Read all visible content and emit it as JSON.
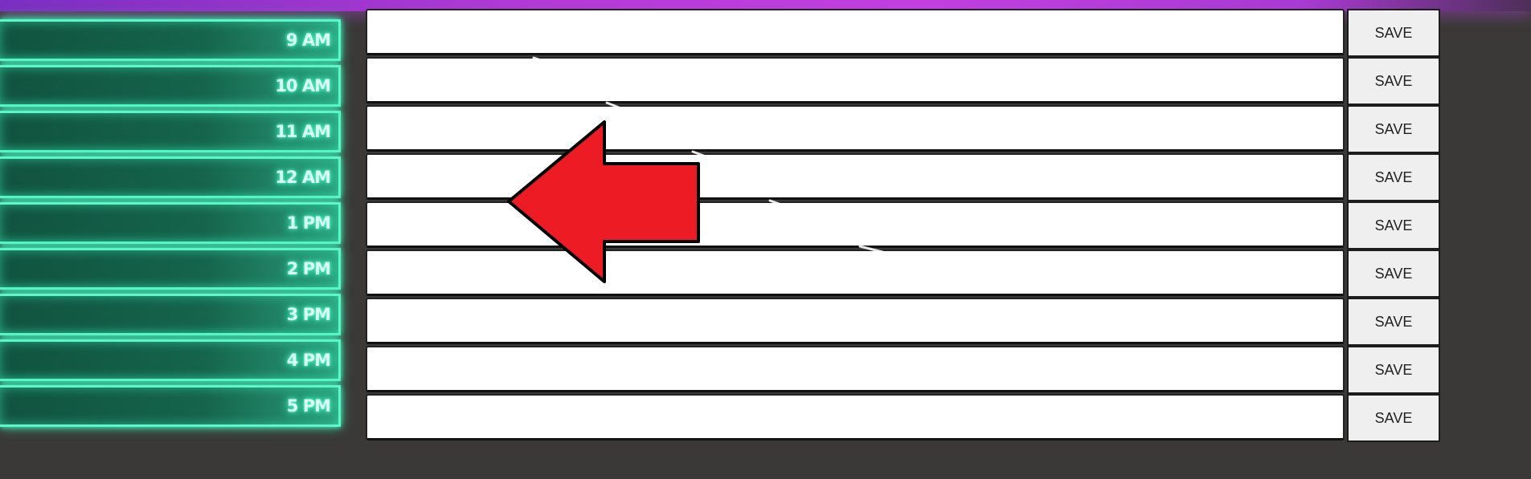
{
  "time_blocks": [
    {
      "label": "9 AM"
    },
    {
      "label": "10 AM"
    },
    {
      "label": "11 AM"
    },
    {
      "label": "12 AM"
    },
    {
      "label": "1 PM"
    },
    {
      "label": "2 PM"
    },
    {
      "label": "3 PM"
    },
    {
      "label": "4 PM"
    },
    {
      "label": "5 PM"
    }
  ],
  "rows": [
    {
      "text": "",
      "save_label": "SAVE"
    },
    {
      "text": "",
      "save_label": "SAVE"
    },
    {
      "text": "",
      "save_label": "SAVE"
    },
    {
      "text": "",
      "save_label": "SAVE"
    },
    {
      "text": "",
      "save_label": "SAVE"
    },
    {
      "text": "",
      "save_label": "SAVE"
    },
    {
      "text": "",
      "save_label": "SAVE"
    },
    {
      "text": "",
      "save_label": "SAVE"
    },
    {
      "text": "",
      "save_label": "SAVE"
    }
  ],
  "colors": {
    "background": "#3a3937",
    "neon_green": "#5cf6c8",
    "top_glow_purple": "#b23ad6",
    "arrow_red": "#ed1c24"
  },
  "icons": {
    "annotation": "red-left-arrow-icon"
  }
}
